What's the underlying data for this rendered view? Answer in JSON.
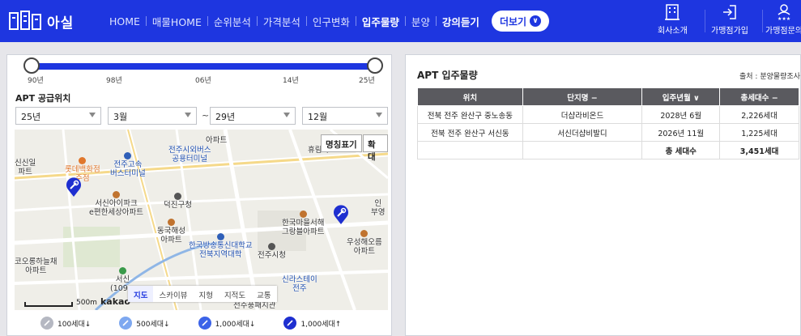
{
  "brand": {
    "name": "아실",
    "color": "#1e36e0"
  },
  "nav": {
    "items": [
      {
        "label": "HOME",
        "active": false
      },
      {
        "label": "매물HOME",
        "active": false
      },
      {
        "label": "순위분석",
        "active": false
      },
      {
        "label": "가격분석",
        "active": false
      },
      {
        "label": "인구변화",
        "active": false
      },
      {
        "label": "입주물량",
        "active": true
      },
      {
        "label": "분양",
        "active": false
      },
      {
        "label": "강의듣기",
        "active": true
      }
    ],
    "more_label": "더보기",
    "right_items": [
      {
        "label": "회사소개",
        "icon": "building-icon"
      },
      {
        "label": "가맹점가입",
        "icon": "login-icon"
      },
      {
        "label": "가맹점문의",
        "icon": "people-icon"
      }
    ]
  },
  "slider": {
    "ticks": [
      "90년",
      "98년",
      "06년",
      "14년",
      "25년"
    ],
    "range_start": "90년",
    "range_end": "25년"
  },
  "supply": {
    "title": "APT 공급위치",
    "from_year": "25년",
    "from_month": "3월",
    "separator": "~",
    "to_year": "29년",
    "to_month": "12월"
  },
  "map": {
    "buttons": {
      "names": "명칭표기",
      "zoom": "확대"
    },
    "labels": {
      "lotte": "롯데백화점\n주점",
      "terminal": "전주고속\n버스터미널",
      "busterm": "전주시외버스\n공용터미널",
      "sinsan": "신신일\n파트",
      "seojin": "서신아이파크\ne편한세상아파트",
      "deokjin": "덕진구청",
      "donguk": "동국해성\n아파트",
      "hanguk": "한국마을서해\n그랑블아파트",
      "ushin": "우성해오름\n아파트",
      "broadcast": "한국방송통신대학교\n전북지역대학",
      "cityhall": "전주시청",
      "koolong": "코오롱하늘채\n아파트",
      "seoshin": "서신\n(109...",
      "shilla": "신라스테이\n전주",
      "hyul": "휴림아",
      "ab": "인\n부영",
      "jeonju": "전주풍패지관",
      "west": "아파트"
    },
    "tabs": [
      "지도",
      "스카이뷰",
      "지형",
      "지적도",
      "교통"
    ],
    "active_tab": "지도",
    "scale": "500m",
    "provider": "kakao"
  },
  "legend": [
    {
      "label": "100세대↓",
      "color": "#b5b8c2"
    },
    {
      "label": "500세대↓",
      "color": "#7ea8f0"
    },
    {
      "label": "1,000세대↓",
      "color": "#3c63e8"
    },
    {
      "label": "1,000세대↑",
      "color": "#1e2fd0"
    }
  ],
  "table": {
    "title": "APT 입주물량",
    "source": "출처 : 분양물량조사",
    "headers": [
      "위치",
      "단지명 −",
      "입주년월 ∨",
      "총세대수 −"
    ],
    "rows": [
      [
        "전북 전주 완산구 중노송동",
        "더샵라비온드",
        "2028년 6월",
        "2,226세대"
      ],
      [
        "전북 전주 완산구 서신동",
        "서신더샵비발디",
        "2026년 11월",
        "1,225세대"
      ]
    ],
    "total_label": "총 세대수",
    "total_value": "3,451세대"
  }
}
